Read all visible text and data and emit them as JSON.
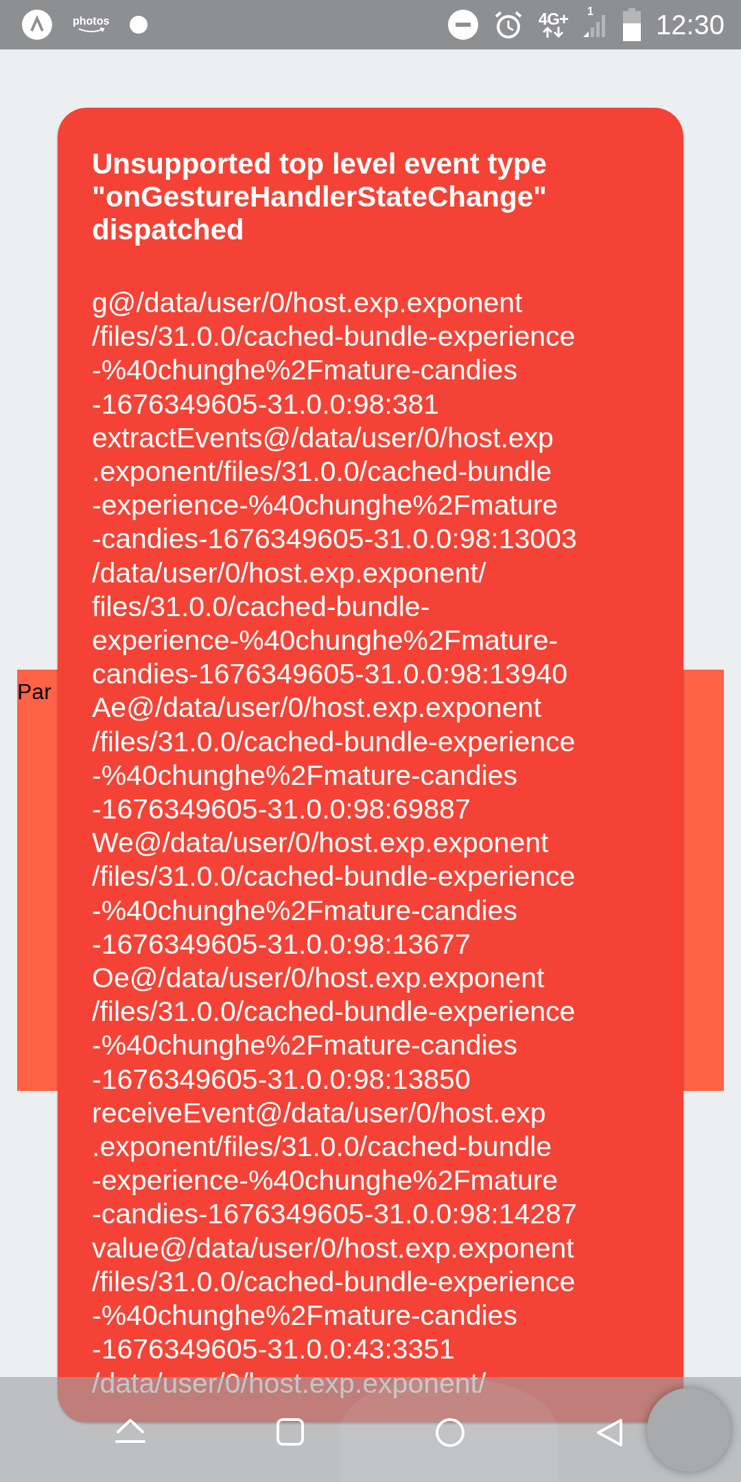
{
  "status_bar": {
    "app_label": "photos",
    "network": "4G+",
    "sim": "1",
    "time": "12:30"
  },
  "panel": {
    "text": "Par"
  },
  "error": {
    "title": "Unsupported top level event type \"onGestureHandlerStateChange\" dispatched",
    "stack_lines": [
      "g@/data/user/0/host.exp.exponent",
      "/files/31.0.0/cached-bundle-experience",
      "-%40chunghe%2Fmature-candies",
      "-1676349605-31.0.0:98:381",
      "extractEvents@/data/user/0/host.exp",
      ".exponent/files/31.0.0/cached-bundle",
      "-experience-%40chunghe%2Fmature",
      "-candies-1676349605-31.0.0:98:13003",
      "/data/user/0/host.exp.exponent/",
      "files/31.0.0/cached-bundle-",
      "experience-%40chunghe%2Fmature-",
      "candies-1676349605-31.0.0:98:13940",
      "Ae@/data/user/0/host.exp.exponent",
      "/files/31.0.0/cached-bundle-experience",
      "-%40chunghe%2Fmature-candies",
      "-1676349605-31.0.0:98:69887",
      "We@/data/user/0/host.exp.exponent",
      "/files/31.0.0/cached-bundle-experience",
      "-%40chunghe%2Fmature-candies",
      "-1676349605-31.0.0:98:13677",
      "Oe@/data/user/0/host.exp.exponent",
      "/files/31.0.0/cached-bundle-experience",
      "-%40chunghe%2Fmature-candies",
      "-1676349605-31.0.0:98:13850",
      "receiveEvent@/data/user/0/host.exp",
      ".exponent/files/31.0.0/cached-bundle",
      "-experience-%40chunghe%2Fmature",
      "-candies-1676349605-31.0.0:98:14287",
      "value@/data/user/0/host.exp.exponent",
      "/files/31.0.0/cached-bundle-experience",
      "-%40chunghe%2Fmature-candies",
      "-1676349605-31.0.0:43:3351",
      "/data/user/0/host.exp.exponent/"
    ]
  }
}
